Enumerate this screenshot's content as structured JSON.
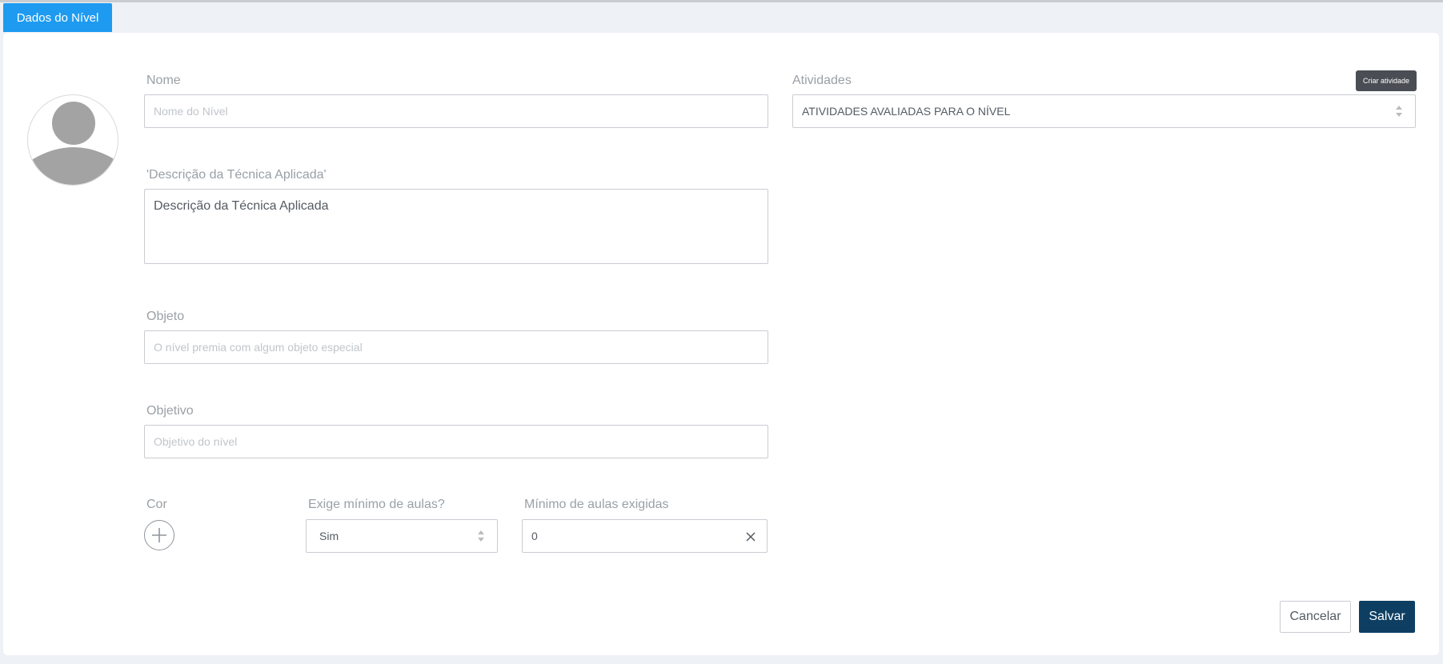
{
  "tab": {
    "label": "Dados do Nível"
  },
  "form": {
    "nome": {
      "label": "Nome",
      "placeholder": "Nome do Nível"
    },
    "descricao": {
      "label": "'Descrição da Técnica Aplicada'",
      "value": "Descrição da Técnica Aplicada"
    },
    "objeto": {
      "label": "Objeto",
      "placeholder": "O nível premia com algum objeto especial"
    },
    "objetivo": {
      "label": "Objetivo",
      "placeholder": "Objetivo do nível"
    },
    "cor": {
      "label": "Cor"
    },
    "exige_minimo": {
      "label": "Exige mínimo de aulas?",
      "value": "Sim"
    },
    "minimo_aulas": {
      "label": "Mínimo de aulas exigidas",
      "value": "0"
    },
    "atividades": {
      "label": "Atividades",
      "value": "ATIVIDADES AVALIADAS PARA O NÍVEL"
    }
  },
  "tooltip": {
    "text": "Criar atividade"
  },
  "actions": {
    "cancel_label": "Cancelar",
    "save_label": "Salvar"
  },
  "colors": {
    "accent": "#1e9bf0",
    "primary": "#0e3f63",
    "background": "#eef1f6",
    "label": "#9aa0a6",
    "border": "#c9ccd1"
  },
  "icons": {
    "avatar": "user-silhouette-icon",
    "select_arrows": "sort-arrows-icon",
    "add": "plus-icon",
    "clear": "close-icon"
  }
}
